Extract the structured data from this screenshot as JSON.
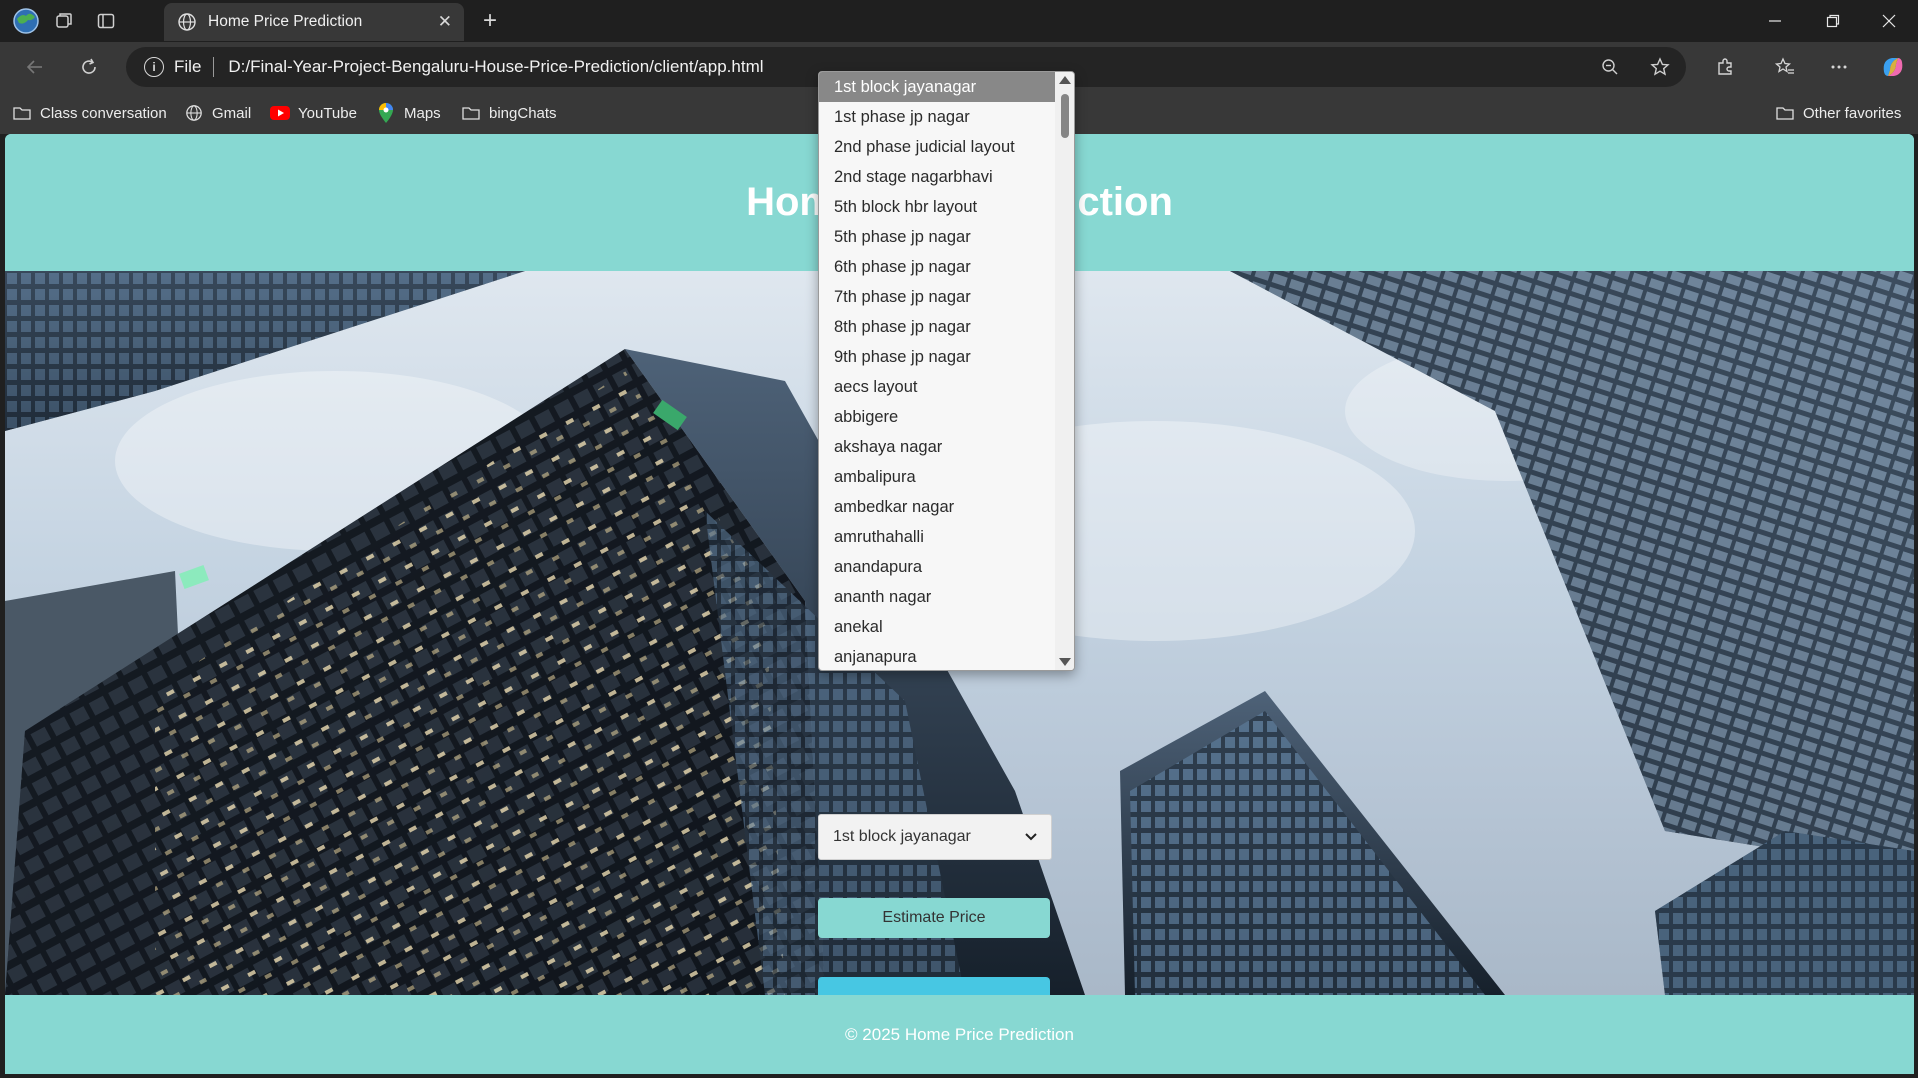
{
  "browser": {
    "tab_title": "Home Price Prediction",
    "tab_close": "✕",
    "new_tab": "+",
    "address_label": "File",
    "url": "D:/Final-Year-Project-Bengaluru-House-Price-Prediction/client/app.html",
    "bookmarks": [
      {
        "label": "Class conversation",
        "icon": "folder-icon"
      },
      {
        "label": "Gmail",
        "icon": "globe-icon"
      },
      {
        "label": "YouTube",
        "icon": "youtube-icon"
      },
      {
        "label": "Maps",
        "icon": "maps-pin-icon"
      },
      {
        "label": "bingChats",
        "icon": "folder-icon"
      }
    ],
    "other_favorites": "Other favorites",
    "accent_color": "#87d8d2"
  },
  "page": {
    "title": "Home Price Prediction",
    "selected_location": "1st block jayanagar",
    "estimate_button": "Estimate Price",
    "result_text": "",
    "footer": "© 2025 Home Price Prediction",
    "colors": {
      "header": "#87d8d2",
      "result_box": "#47c7e3"
    }
  },
  "dropdown": {
    "options": [
      "1st block jayanagar",
      "1st phase jp nagar",
      "2nd phase judicial layout",
      "2nd stage nagarbhavi",
      "5th block hbr layout",
      "5th phase jp nagar",
      "6th phase jp nagar",
      "7th phase jp nagar",
      "8th phase jp nagar",
      "9th phase jp nagar",
      "aecs layout",
      "abbigere",
      "akshaya nagar",
      "ambalipura",
      "ambedkar nagar",
      "amruthahalli",
      "anandapura",
      "ananth nagar",
      "anekal",
      "anjanapura"
    ]
  }
}
